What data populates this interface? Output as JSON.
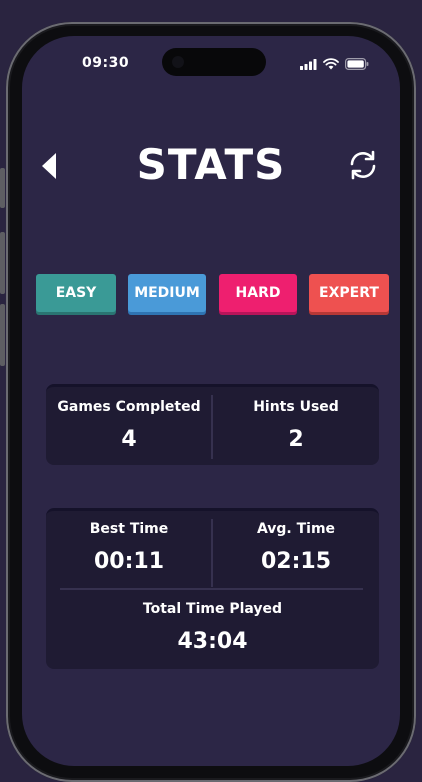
{
  "status_bar": {
    "time": "09:30"
  },
  "header": {
    "title": "STATS",
    "back_icon": "back-arrow-icon",
    "refresh_icon": "refresh-icon"
  },
  "tabs": [
    {
      "label": "EASY",
      "color": "#3a9a96"
    },
    {
      "label": "MEDIUM",
      "color": "#4a9ad8"
    },
    {
      "label": "HARD",
      "color": "#ee1f6f"
    },
    {
      "label": "EXPERT",
      "color": "#ee5150"
    }
  ],
  "stats": {
    "games_completed": {
      "label": "Games Completed",
      "value": "4"
    },
    "hints_used": {
      "label": "Hints Used",
      "value": "2"
    },
    "best_time": {
      "label": "Best Time",
      "value": "00:11"
    },
    "avg_time": {
      "label": "Avg. Time",
      "value": "02:15"
    },
    "total_time": {
      "label": "Total Time Played",
      "value": "43:04"
    }
  },
  "colors": {
    "background": "#2c2646",
    "card": "#1f1b33",
    "text": "#ffffff"
  }
}
